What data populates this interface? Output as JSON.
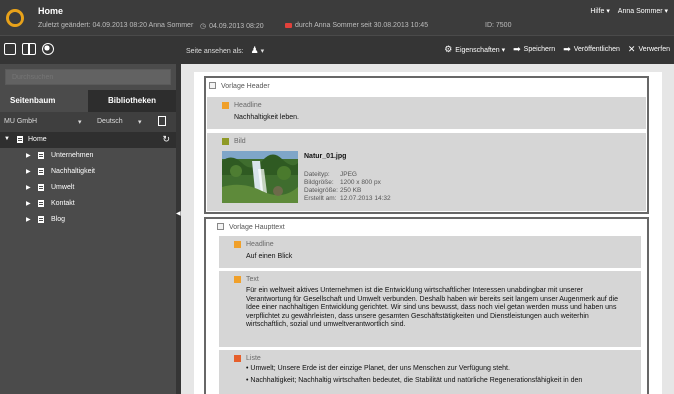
{
  "header": {
    "title": "Home",
    "last_changed": "Zuletzt geändert: 04.09.2013 08:20 Anna Sommer",
    "scheduled": "04.09.2013 08:20",
    "locked_by": "durch Anna Sommer seit 30.08.2013 10:45",
    "id_label": "ID: 7500",
    "help_menu": "Hilfe ▾",
    "user_menu": "Anna Sommer ▾"
  },
  "toolbar": {
    "view_as_label": "Seite ansehen als:",
    "view_as_value": "▾",
    "properties": "Eigenschaften ▾",
    "save": "Speichern",
    "publish": "Veröffentlichen",
    "discard": "Verwerfen"
  },
  "sidebar": {
    "search_placeholder": "Durchsuchen",
    "tabs": [
      "Seitenbaum",
      "Bibliotheken"
    ],
    "site": "MU GmbH",
    "language": "Deutsch",
    "tree": {
      "root": "Home",
      "children": [
        "Unternehmen",
        "Nachhaltigkeit",
        "Umwelt",
        "Kontakt",
        "Blog"
      ]
    }
  },
  "content": {
    "header_template": "Vorlage Header",
    "headline1_title": "Headline",
    "headline1_text": "Nachhaltigkeit leben.",
    "image_title": "Bild",
    "image_name": "Natur_01.jpg",
    "image_meta": {
      "type_key": "Dateityp:",
      "type_val": "JPEG",
      "size_key": "Bildgröße:",
      "size_val": "1200 x 800 px",
      "fsize_key": "Dateigröße:",
      "fsize_val": "250 KB",
      "created_key": "Erstellt am:",
      "created_val": "12.07.2013 14:32"
    },
    "main_template": "Vorlage Haupttext",
    "headline2_title": "Headline",
    "headline2_text": "Auf einen Blick",
    "text_title": "Text",
    "text_body": "Für ein weltweit aktives Unternehmen ist die Entwicklung wirtschaftlicher Interessen unabdingbar mit unserer Verantwortung für Gesellschaft und Umwelt verbunden. Deshalb haben wir bereits seit langem unser Augenmerk auf die Idee einer nachhaltigen Entwicklung gerichtet. Wir sind uns bewusst, dass noch viel getan werden muss und haben uns verpflichtet zu gewährleisten, dass unsere gesamten Geschäftstätigkeiten und Dienstleistungen auch weiterhin wirtschaftlich, sozial und umweltverantwortlich sind.",
    "list_title": "Liste",
    "list_items": [
      "• Umwelt; Unsere Erde ist der einzige Planet, der uns Menschen zur Verfügung steht.",
      "• Nachhaltigkeit; Nachhaltig wirtschaften bedeutet, die Stabilität und natürliche Regenerationsfähigkeit in den"
    ]
  },
  "colors": {
    "accent": "#f0a02a",
    "image_badge": "#8f9a26",
    "list_badge": "#e65f2b",
    "dark": "#3c3c3c"
  }
}
